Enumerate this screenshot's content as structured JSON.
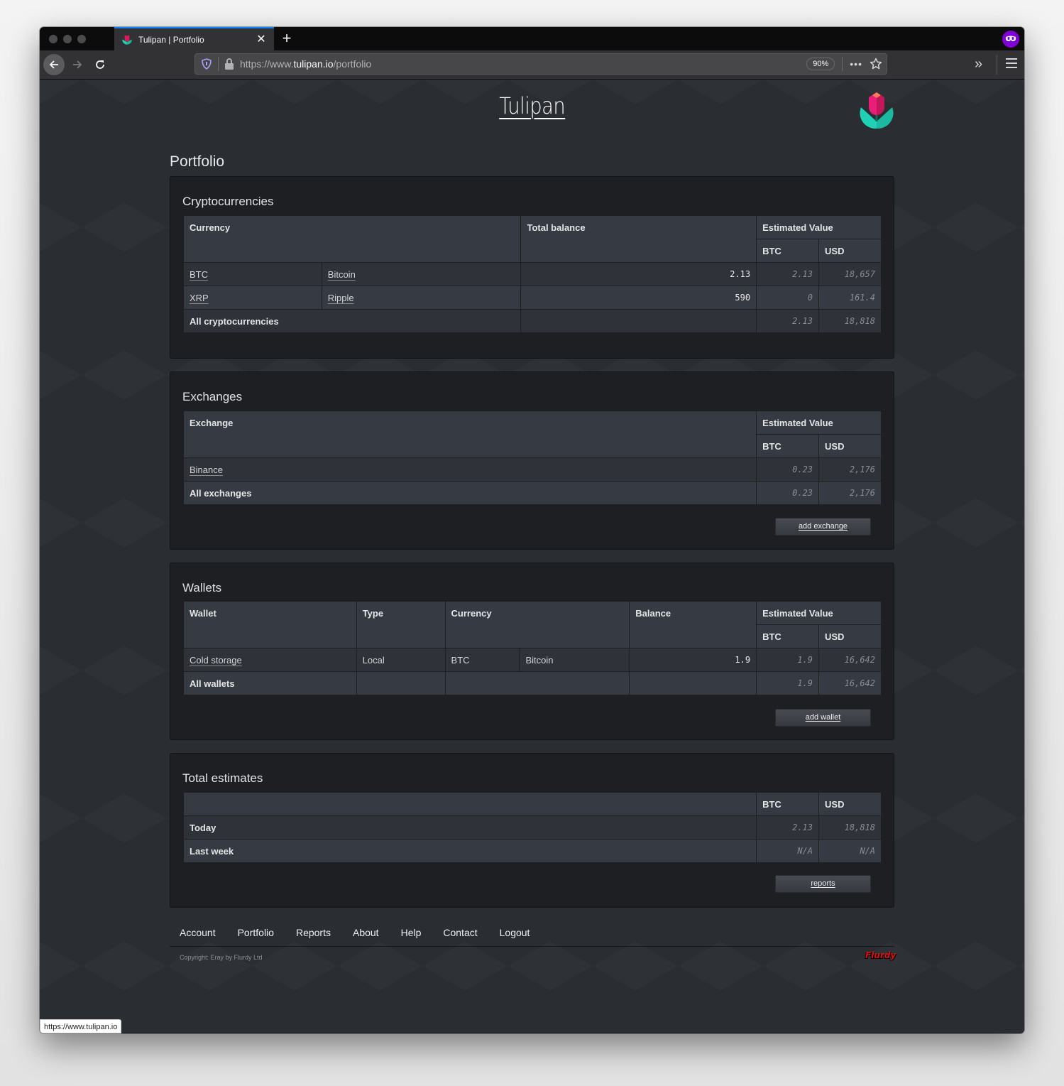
{
  "browser": {
    "tab_title": "Tulipan | Portfolio",
    "url_prefix": "https://www.",
    "url_domain": "tulipan.io",
    "url_path": "/portfolio",
    "zoom_level": "90%",
    "status_url": "https://www.tulipan.io"
  },
  "site": {
    "title": "Tulipan",
    "page_heading": "Portfolio"
  },
  "cryptocurrencies": {
    "heading": "Cryptocurrencies",
    "columns": {
      "currency": "Currency",
      "total_balance": "Total balance",
      "estimated_value": "Estimated Value",
      "btc": "BTC",
      "usd": "USD"
    },
    "rows": [
      {
        "code": "BTC",
        "name": "Bitcoin",
        "balance": "2.13",
        "btc": "2.13",
        "usd": "18,657"
      },
      {
        "code": "XRP",
        "name": "Ripple",
        "balance": "590",
        "btc": "0",
        "usd": "161.4"
      }
    ],
    "total": {
      "label": "All cryptocurrencies",
      "btc": "2.13",
      "usd": "18,818"
    }
  },
  "exchanges": {
    "heading": "Exchanges",
    "columns": {
      "exchange": "Exchange",
      "estimated_value": "Estimated Value",
      "btc": "BTC",
      "usd": "USD"
    },
    "rows": [
      {
        "name": "Binance",
        "btc": "0.23",
        "usd": "2,176"
      }
    ],
    "total": {
      "label": "All exchanges",
      "btc": "0.23",
      "usd": "2,176"
    },
    "add_button": "add exchange"
  },
  "wallets": {
    "heading": "Wallets",
    "columns": {
      "wallet": "Wallet",
      "type": "Type",
      "currency": "Currency",
      "balance": "Balance",
      "estimated_value": "Estimated Value",
      "btc": "BTC",
      "usd": "USD"
    },
    "rows": [
      {
        "name": "Cold storage",
        "type": "Local",
        "code": "BTC",
        "currency_name": "Bitcoin",
        "balance": "1.9",
        "btc": "1.9",
        "usd": "16,642"
      }
    ],
    "total": {
      "label": "All wallets",
      "btc": "1.9",
      "usd": "16,642"
    },
    "add_button": "add wallet"
  },
  "totals": {
    "heading": "Total estimates",
    "columns": {
      "btc": "BTC",
      "usd": "USD"
    },
    "rows": [
      {
        "label": "Today",
        "btc": "2.13",
        "usd": "18,818"
      },
      {
        "label": "Last week",
        "btc": "N/A",
        "usd": "N/A"
      }
    ],
    "reports_button": "reports"
  },
  "footer": {
    "nav": [
      "Account",
      "Portfolio",
      "Reports",
      "About",
      "Help",
      "Contact",
      "Logout"
    ],
    "copyright": "Copyright: Eray by Flurdy Ltd",
    "brand": "Flurdy"
  },
  "colors": {
    "accent_tab": "#0a84ff",
    "private_badge": "#8000d7",
    "page_bg": "#2a2d31",
    "card_bg": "#1e1f23",
    "header_cell": "#363a42",
    "flurdy_red": "#e01010"
  }
}
